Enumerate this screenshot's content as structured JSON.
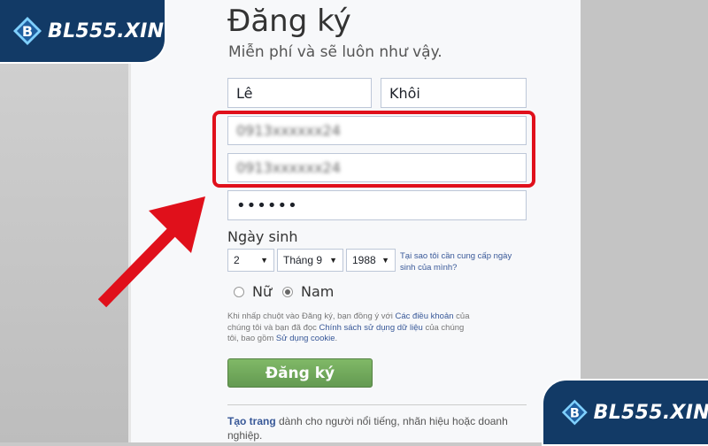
{
  "brand": {
    "text": "BL555.XIN",
    "icon": "diamond-b-logo-icon",
    "color": "#123a66"
  },
  "form": {
    "title": "Đăng ký",
    "subtitle": "Miễn phí và sẽ luôn như vậy.",
    "first_name": "Lê",
    "last_name": "Khôi",
    "phone": "0913xxxxxx24",
    "phone_confirm": "0913xxxxxx24",
    "password_mask": "••••••",
    "dob_label": "Ngày sinh",
    "day": "2",
    "month": "Tháng 9",
    "year": "1988",
    "why_link": "Tại sao tôi cần cung cấp ngày sinh của mình?",
    "gender_female": "Nữ",
    "gender_male": "Nam",
    "gender_selected": "Nam",
    "terms_1": "Khi nhấp chuột vào Đăng ký, bạn đồng ý với ",
    "terms_link_1": "Các điều khoản",
    "terms_2": " của chúng tôi và bạn đã đọc ",
    "terms_link_2": "Chính sách sử dụng dữ liệu",
    "terms_3": " của chúng tôi, bao gồm ",
    "terms_link_3": "Sử dụng cookie",
    "terms_4": ".",
    "submit_label": "Đăng ký",
    "create_page_link": "Tạo trang",
    "create_page_text": " dành cho người nổi tiếng, nhãn hiệu hoặc doanh nghiệp."
  },
  "annotation": {
    "highlight_color": "#e0101b",
    "arrow_color": "#e0101b"
  }
}
